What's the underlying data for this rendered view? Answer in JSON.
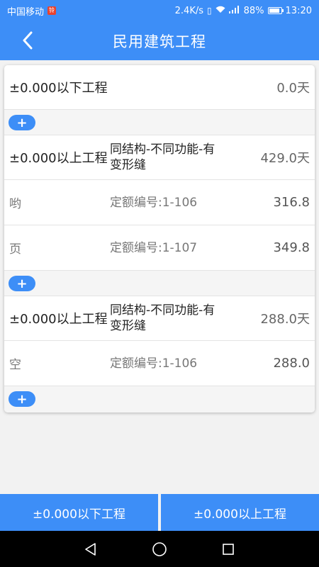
{
  "status_bar": {
    "carrier": "中国移动",
    "carrier_badge": "铃",
    "speed": "2.4K/s",
    "signal_glyphs": "ᴴ⁴⁶",
    "battery_pct": "88%",
    "time": "13:20"
  },
  "header": {
    "title": "民用建筑工程",
    "back_icon": "chevron-left-icon"
  },
  "rows": {
    "below": {
      "name": "±0.000以下工程",
      "days": "0.0天"
    },
    "above1": {
      "name": "±0.000以上工程",
      "desc": "同结构-不同功能-有变形缝",
      "days": "429.0天"
    },
    "above1_sub1": {
      "name": "哟",
      "code": "定额编号:1-106",
      "value": "316.8"
    },
    "above1_sub2": {
      "name": "页",
      "code": "定额编号:1-107",
      "value": "349.8"
    },
    "above2": {
      "name": "±0.000以上工程",
      "desc": "同结构-不同功能-有变形缝",
      "days": "288.0天"
    },
    "above2_sub1": {
      "name": "空",
      "code": "定额编号:1-106",
      "value": "288.0"
    }
  },
  "add_label": "+",
  "bottom_buttons": {
    "below": "±0.000以下工程",
    "above": "±0.000以上工程"
  },
  "colors": {
    "accent": "#3d8ef7",
    "background": "#f2f2f2"
  }
}
